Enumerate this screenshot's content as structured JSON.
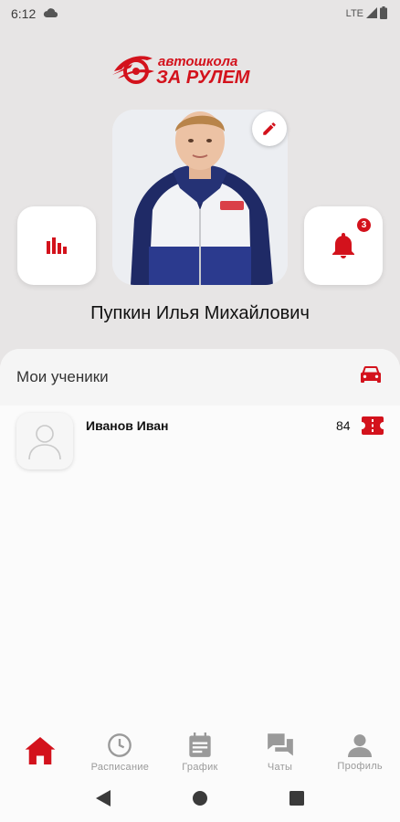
{
  "status_bar": {
    "time": "6:12",
    "network": "LTE"
  },
  "logo": {
    "line1": "автошкола",
    "line2": "ЗА РУЛЕМ"
  },
  "profile": {
    "name": "Пупкин Илья Михайлович",
    "notifications_count": "3"
  },
  "students_section": {
    "title": "Мои ученики"
  },
  "students": [
    {
      "name": "Иванов Иван",
      "count": "84"
    }
  ],
  "bottom_nav": {
    "items": [
      {
        "label": "",
        "icon": "home-icon",
        "active": true
      },
      {
        "label": "Расписание",
        "icon": "clock-icon",
        "active": false
      },
      {
        "label": "График",
        "icon": "calendar-icon",
        "active": false
      },
      {
        "label": "Чаты",
        "icon": "chat-icon",
        "active": false
      },
      {
        "label": "Профиль",
        "icon": "person-icon",
        "active": false
      }
    ]
  },
  "colors": {
    "accent": "#d3121c",
    "background": "#e7e5e5",
    "inactive": "#9a9a9a"
  }
}
